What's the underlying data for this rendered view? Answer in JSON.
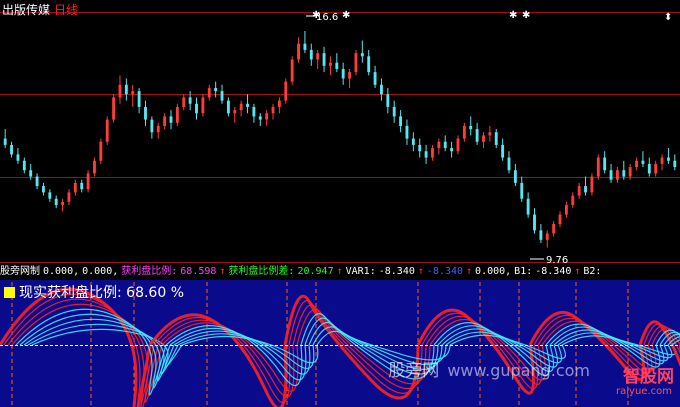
{
  "header": {
    "stock_name": "出版传媒",
    "period": "日线"
  },
  "price_panel": {
    "high_label": "16.6",
    "low_label": "9.76"
  },
  "indicator_bar": {
    "name": "股旁网制",
    "v1": "0.000,",
    "v2": "0.000,",
    "profit_label": "获利盘比例:",
    "profit_value": "68.598",
    "profit_diff_label": "获利盘比例差:",
    "profit_diff_value": "20.947",
    "var1_label": "VAR1:",
    "var1_value": "-8.340",
    "blue_value": "-8.340",
    "v3": "0.000,",
    "b1_label": "B1:",
    "b1_value": "-8.340",
    "b2_label": "B2:",
    "arrow": "↑"
  },
  "real_ratio": {
    "label": "现实获利盘比例:",
    "value": "68.60",
    "unit": "%"
  },
  "watermark": {
    "text": "股旁网",
    "domain": "www.gupang.com",
    "logo_name": "智股网",
    "logo_sub": "raiyue.com"
  },
  "colors": {
    "up": "#ff3b3b",
    "down": "#54e8f0",
    "grid": "#a01010",
    "panel_bg": "#0a0a8c",
    "wave_red": "#ff2020",
    "wave_cyan": "#40e8ff"
  },
  "chart_data": {
    "type": "candlestick",
    "ylim": [
      9.3,
      17.2
    ],
    "ohlc": [
      [
        13.2,
        13.5,
        12.9,
        13.0
      ],
      [
        13.0,
        13.1,
        12.6,
        12.7
      ],
      [
        12.7,
        12.9,
        12.4,
        12.5
      ],
      [
        12.5,
        12.6,
        12.1,
        12.2
      ],
      [
        12.2,
        12.4,
        11.9,
        12.0
      ],
      [
        12.0,
        12.1,
        11.6,
        11.7
      ],
      [
        11.7,
        11.8,
        11.4,
        11.5
      ],
      [
        11.5,
        11.6,
        11.2,
        11.3
      ],
      [
        11.3,
        11.4,
        11.0,
        11.1
      ],
      [
        11.1,
        11.3,
        10.9,
        11.2
      ],
      [
        11.2,
        11.6,
        11.1,
        11.5
      ],
      [
        11.5,
        11.9,
        11.4,
        11.8
      ],
      [
        11.8,
        11.9,
        11.5,
        11.6
      ],
      [
        11.6,
        12.2,
        11.5,
        12.1
      ],
      [
        12.1,
        12.6,
        12.0,
        12.5
      ],
      [
        12.5,
        13.2,
        12.4,
        13.1
      ],
      [
        13.1,
        13.9,
        13.0,
        13.8
      ],
      [
        13.8,
        14.6,
        13.7,
        14.5
      ],
      [
        14.5,
        15.2,
        14.3,
        14.9
      ],
      [
        14.9,
        15.1,
        14.4,
        14.6
      ],
      [
        14.6,
        14.9,
        14.2,
        14.7
      ],
      [
        14.7,
        14.8,
        14.0,
        14.2
      ],
      [
        14.2,
        14.4,
        13.6,
        13.8
      ],
      [
        13.8,
        13.9,
        13.2,
        13.4
      ],
      [
        13.4,
        13.7,
        13.2,
        13.6
      ],
      [
        13.6,
        14.0,
        13.5,
        13.9
      ],
      [
        13.9,
        14.1,
        13.5,
        13.7
      ],
      [
        13.7,
        14.3,
        13.6,
        14.2
      ],
      [
        14.2,
        14.6,
        14.1,
        14.5
      ],
      [
        14.5,
        14.7,
        14.1,
        14.3
      ],
      [
        14.3,
        14.5,
        13.8,
        14.0
      ],
      [
        14.0,
        14.6,
        13.9,
        14.5
      ],
      [
        14.5,
        14.9,
        14.4,
        14.8
      ],
      [
        14.8,
        15.0,
        14.5,
        14.7
      ],
      [
        14.7,
        14.9,
        14.3,
        14.4
      ],
      [
        14.4,
        14.5,
        13.9,
        14.0
      ],
      [
        14.0,
        14.2,
        13.7,
        14.1
      ],
      [
        14.1,
        14.4,
        13.9,
        14.3
      ],
      [
        14.3,
        14.6,
        14.0,
        14.2
      ],
      [
        14.2,
        14.3,
        13.7,
        13.9
      ],
      [
        13.9,
        14.0,
        13.6,
        13.8
      ],
      [
        13.8,
        14.1,
        13.6,
        14.0
      ],
      [
        14.0,
        14.3,
        13.8,
        14.2
      ],
      [
        14.2,
        14.5,
        14.0,
        14.4
      ],
      [
        14.4,
        15.1,
        14.3,
        15.0
      ],
      [
        15.0,
        15.8,
        14.9,
        15.7
      ],
      [
        15.7,
        16.4,
        15.6,
        16.2
      ],
      [
        16.2,
        16.6,
        15.9,
        16.0
      ],
      [
        16.0,
        16.2,
        15.5,
        15.7
      ],
      [
        15.7,
        16.0,
        15.4,
        15.9
      ],
      [
        15.9,
        16.1,
        15.3,
        15.5
      ],
      [
        15.5,
        15.8,
        15.2,
        15.6
      ],
      [
        15.6,
        15.9,
        15.3,
        15.4
      ],
      [
        15.4,
        15.6,
        14.9,
        15.1
      ],
      [
        15.1,
        15.4,
        14.8,
        15.3
      ],
      [
        15.3,
        16.0,
        15.2,
        15.9
      ],
      [
        15.9,
        16.3,
        15.6,
        15.8
      ],
      [
        15.8,
        16.0,
        15.2,
        15.3
      ],
      [
        15.3,
        15.5,
        14.8,
        14.9
      ],
      [
        14.9,
        15.1,
        14.4,
        14.6
      ],
      [
        14.6,
        14.8,
        14.0,
        14.2
      ],
      [
        14.2,
        14.4,
        13.7,
        13.9
      ],
      [
        13.9,
        14.1,
        13.4,
        13.6
      ],
      [
        13.6,
        13.8,
        13.0,
        13.2
      ],
      [
        13.2,
        13.4,
        12.8,
        13.0
      ],
      [
        13.0,
        13.2,
        12.6,
        12.8
      ],
      [
        12.8,
        13.0,
        12.4,
        12.6
      ],
      [
        12.6,
        13.0,
        12.5,
        12.9
      ],
      [
        12.9,
        13.2,
        12.7,
        13.1
      ],
      [
        13.1,
        13.3,
        12.8,
        12.9
      ],
      [
        12.9,
        13.1,
        12.6,
        12.8
      ],
      [
        12.8,
        13.3,
        12.7,
        13.2
      ],
      [
        13.2,
        13.7,
        13.1,
        13.6
      ],
      [
        13.6,
        13.9,
        13.3,
        13.5
      ],
      [
        13.5,
        13.7,
        13.0,
        13.1
      ],
      [
        13.1,
        13.4,
        12.9,
        13.3
      ],
      [
        13.3,
        13.6,
        13.1,
        13.4
      ],
      [
        13.4,
        13.5,
        12.9,
        13.0
      ],
      [
        13.0,
        13.2,
        12.5,
        12.6
      ],
      [
        12.6,
        12.8,
        12.1,
        12.2
      ],
      [
        12.2,
        12.4,
        11.7,
        11.8
      ],
      [
        11.8,
        12.0,
        11.2,
        11.3
      ],
      [
        11.3,
        11.5,
        10.7,
        10.8
      ],
      [
        10.8,
        11.0,
        10.2,
        10.3
      ],
      [
        10.3,
        10.5,
        9.9,
        10.0
      ],
      [
        10.0,
        10.3,
        9.76,
        10.2
      ],
      [
        10.2,
        10.6,
        10.1,
        10.5
      ],
      [
        10.5,
        10.9,
        10.4,
        10.8
      ],
      [
        10.8,
        11.2,
        10.7,
        11.1
      ],
      [
        11.1,
        11.5,
        11.0,
        11.4
      ],
      [
        11.4,
        11.8,
        11.3,
        11.7
      ],
      [
        11.7,
        12.0,
        11.4,
        11.5
      ],
      [
        11.5,
        12.1,
        11.4,
        12.0
      ],
      [
        12.0,
        12.7,
        11.9,
        12.6
      ],
      [
        12.6,
        12.8,
        12.1,
        12.2
      ],
      [
        12.2,
        12.4,
        11.8,
        11.9
      ],
      [
        11.9,
        12.3,
        11.8,
        12.2
      ],
      [
        12.2,
        12.5,
        11.9,
        12.0
      ],
      [
        12.0,
        12.4,
        11.9,
        12.3
      ],
      [
        12.3,
        12.6,
        12.2,
        12.5
      ],
      [
        12.5,
        12.8,
        12.3,
        12.4
      ],
      [
        12.4,
        12.6,
        12.0,
        12.1
      ],
      [
        12.1,
        12.5,
        12.0,
        12.4
      ],
      [
        12.4,
        12.7,
        12.2,
        12.6
      ],
      [
        12.6,
        12.9,
        12.4,
        12.5
      ],
      [
        12.5,
        12.7,
        12.2,
        12.3
      ]
    ]
  }
}
